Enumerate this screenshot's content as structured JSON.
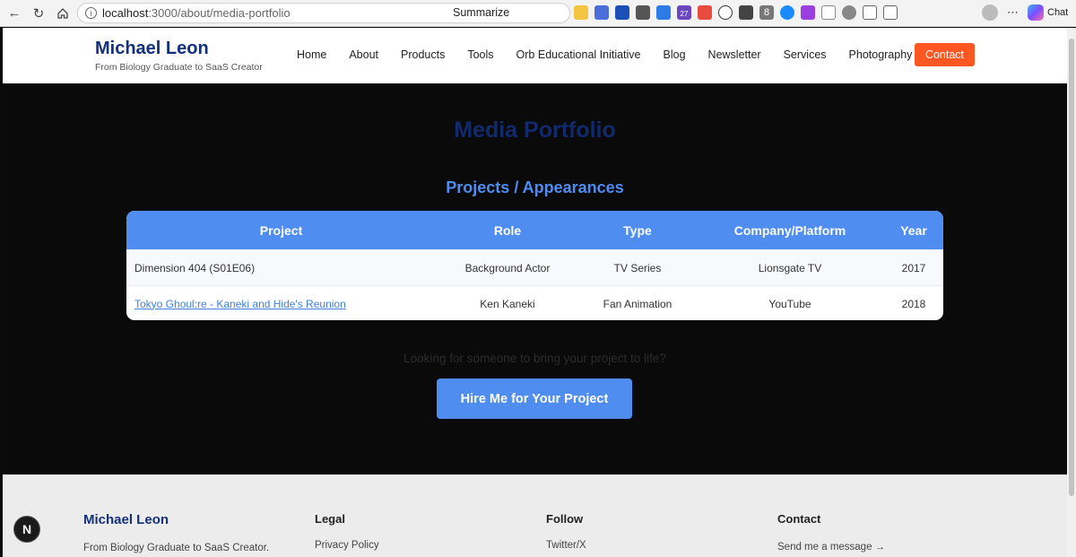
{
  "browser": {
    "url_host": "localhost",
    "url_path": ":3000/about/media-portfolio",
    "summarize_label": "Summarize",
    "chat_label": "Chat",
    "extension_badge_number": "8",
    "calendar_badge_number": "27"
  },
  "header": {
    "brand_name": "Michael Leon",
    "tagline": "From Biology Graduate to SaaS Creator",
    "nav": [
      "Home",
      "About",
      "Products",
      "Tools",
      "Orb Educational Initiative",
      "Blog",
      "Newsletter",
      "Services",
      "Photography"
    ],
    "contact_label": "Contact"
  },
  "main": {
    "page_title": "Media Portfolio",
    "section_title": "Projects / Appearances",
    "table": {
      "headers": [
        "Project",
        "Role",
        "Type",
        "Company/Platform",
        "Year"
      ],
      "rows": [
        [
          "Dimension 404 (S01E06)",
          "Background Actor",
          "TV Series",
          "Lionsgate TV",
          "2017"
        ],
        [
          "Tokyo Ghoul:re - Kaneki and Hide's Reunion",
          "Ken Kaneki",
          "Fan Animation",
          "YouTube",
          "2018"
        ]
      ]
    },
    "cta_text": "Looking for someone to bring your project to life?",
    "cta_button": "Hire Me for Your Project"
  },
  "footer": {
    "brand_name": "Michael Leon",
    "tagline": "From Biology Graduate to SaaS Creator.",
    "legal_heading": "Legal",
    "legal_link": "Privacy Policy",
    "follow_heading": "Follow",
    "follow_link": "Twitter/X",
    "contact_heading": "Contact",
    "contact_link": "Send me a message →"
  },
  "dev_badge": "N",
  "colors": {
    "brand_navy": "#13307a",
    "accent_blue": "#4f8ef0",
    "contact_orange": "#ff5722"
  }
}
